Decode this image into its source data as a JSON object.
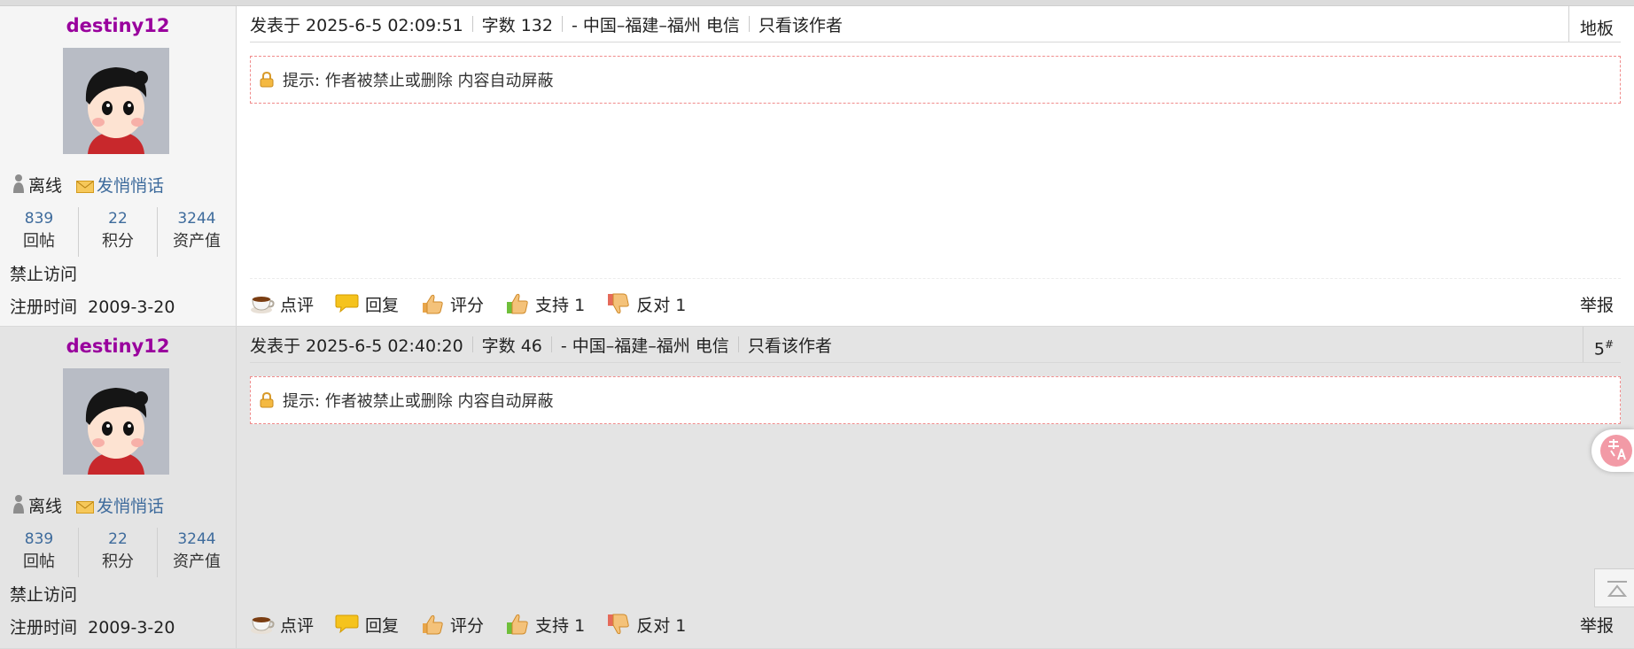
{
  "posts": [
    {
      "username": "destiny12",
      "status": "离线",
      "pm_label": "发悄悄话",
      "stats": [
        {
          "value": "839",
          "label": "回帖"
        },
        {
          "value": "22",
          "label": "积分"
        },
        {
          "value": "3244",
          "label": "资产值"
        }
      ],
      "banned": "禁止访问",
      "reg_label": "注册时间",
      "reg_date": "2009-3-20",
      "posted": "发表于 2025-6-5 02:09:51",
      "word_count": "字数 132",
      "location": "- 中国–福建–福州 电信",
      "only_author": "只看该作者",
      "floor": "地板",
      "floor_sup": "",
      "notice": "提示: 作者被禁止或删除 内容自动屏蔽",
      "actions": {
        "comment": "点评",
        "reply": "回复",
        "rate": "评分",
        "support": "支持 1",
        "oppose": "反对 1"
      },
      "report": "举报"
    },
    {
      "username": "destiny12",
      "status": "离线",
      "pm_label": "发悄悄话",
      "stats": [
        {
          "value": "839",
          "label": "回帖"
        },
        {
          "value": "22",
          "label": "积分"
        },
        {
          "value": "3244",
          "label": "资产值"
        }
      ],
      "banned": "禁止访问",
      "reg_label": "注册时间",
      "reg_date": "2009-3-20",
      "posted": "发表于 2025-6-5 02:40:20",
      "word_count": "字数 46",
      "location": "- 中国–福建–福州 电信",
      "only_author": "只看该作者",
      "floor": "5",
      "floor_sup": "#",
      "notice": "提示: 作者被禁止或删除 内容自动屏蔽",
      "actions": {
        "comment": "点评",
        "reply": "回复",
        "rate": "评分",
        "support": "支持 1",
        "oppose": "反对 1"
      },
      "report": "举报"
    }
  ],
  "colors": {
    "username": "#99009d",
    "link": "#3e6b9c",
    "notice_border": "#f08b8b"
  },
  "icons": {
    "offline": "person-icon",
    "pm": "envelope-icon",
    "notice": "lock-icon",
    "comment": "coffee-cup-icon",
    "reply": "speech-bubble-icon",
    "rate": "rate-hand-icon",
    "support": "thumbs-up-icon",
    "oppose": "thumbs-down-icon"
  }
}
